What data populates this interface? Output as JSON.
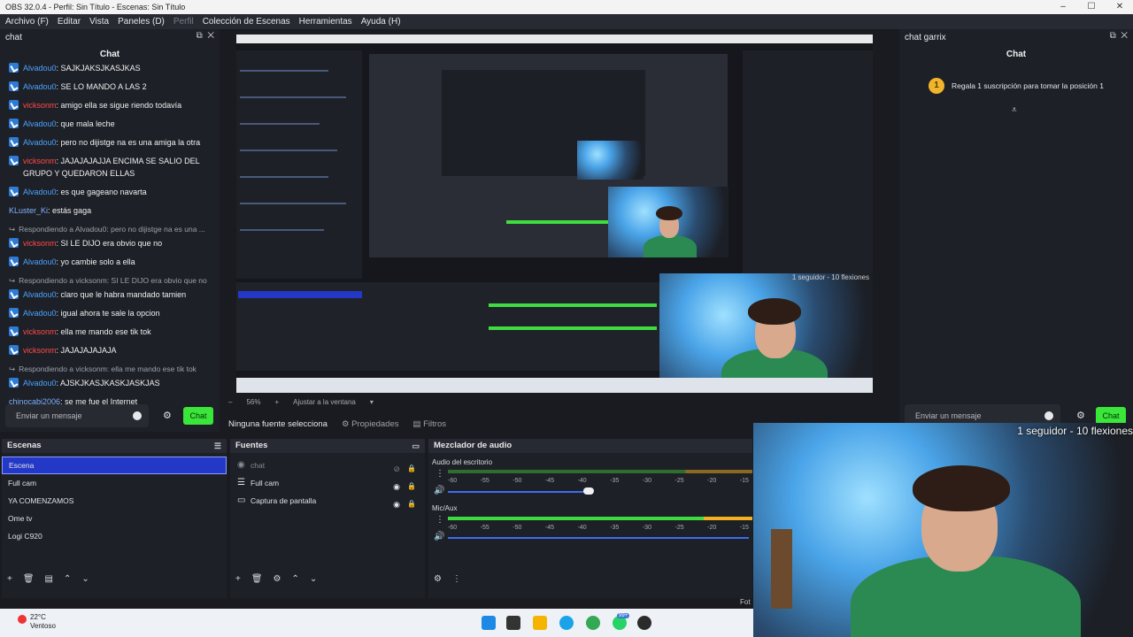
{
  "window": {
    "title": "OBS 32.0.4 - Perfil: Sin Título - Escenas: Sin Título"
  },
  "menu": [
    {
      "label": "Archivo (F)",
      "enabled": true
    },
    {
      "label": "Editar",
      "enabled": true
    },
    {
      "label": "Vista",
      "enabled": true
    },
    {
      "label": "Paneles (D)",
      "enabled": true
    },
    {
      "label": "Perfil",
      "enabled": false
    },
    {
      "label": "Colección de Escenas",
      "enabled": true
    },
    {
      "label": "Herramientas",
      "enabled": true
    },
    {
      "label": "Ayuda (H)",
      "enabled": true
    }
  ],
  "left_dock": {
    "dock_title": "chat",
    "chat_header": "Chat",
    "messages": [
      {
        "user": "Alvadou0",
        "text": "SAJKJAKSJKASJKAS",
        "color": "blue",
        "badge": true
      },
      {
        "user": "Alvadou0",
        "text": "SE LO MANDO A LAS 2",
        "color": "blue",
        "badge": true
      },
      {
        "user": "vicksonm",
        "text": "amigo ella se sigue riendo todavía",
        "color": "red",
        "badge": true
      },
      {
        "user": "Alvadou0",
        "text": "que mala leche",
        "color": "blue",
        "badge": true
      },
      {
        "user": "Alvadou0",
        "text": "pero no dijistge na es una amiga la otra",
        "color": "blue",
        "badge": true
      },
      {
        "user": "vicksonm",
        "text": "JAJAJAJAJJA ENCIMA SE SALIO DEL GRUPO Y QUEDARON ELLAS",
        "color": "red",
        "badge": true
      },
      {
        "user": "Alvadou0",
        "text": "es que gageano navarta",
        "color": "blue",
        "badge": true
      },
      {
        "user": "KLuster_Ki",
        "text": "estás gaga",
        "color": "plain",
        "badge": false
      },
      {
        "reply": "Respondiendo a Alvadou0: pero no dijistge na es una ...",
        "user": "vicksonm",
        "text": "SI LE DIJO era obvio que no",
        "color": "red",
        "badge": true
      },
      {
        "user": "Alvadou0",
        "text": "yo cambie solo a ella",
        "color": "blue",
        "badge": true
      },
      {
        "reply": "Respondiendo a vicksonm: SI LE DIJO era obvio que no",
        "user": "Alvadou0",
        "text": "claro que le habra mandado tamien",
        "color": "blue",
        "badge": true
      },
      {
        "user": "Alvadou0",
        "text": "igual ahora te sale la opcion",
        "color": "blue",
        "badge": true
      },
      {
        "user": "vicksonm",
        "text": "ella me mando ese tik tok",
        "color": "red",
        "badge": true
      },
      {
        "user": "vicksonm",
        "text": "JAJAJAJAJAJA",
        "color": "red",
        "badge": true
      },
      {
        "reply": "Respondiendo a vicksonm: ella me mando ese tik tok",
        "user": "Alvadou0",
        "text": "AJSKJKASJKASKJASKJAS",
        "color": "blue",
        "badge": true
      },
      {
        "user": "chinocabj2006",
        "text": "se me fue el Internet",
        "color": "plain",
        "badge": false
      }
    ],
    "input_placeholder": "Enviar un mensaje",
    "send_label": "Chat"
  },
  "right_dock": {
    "dock_title": "chat garrix",
    "chat_header": "Chat",
    "gift_text": "Regala 1 suscripción para tomar la posición 1",
    "gift_badge": "1",
    "input_placeholder": "Enviar un mensaje",
    "send_label": "Chat"
  },
  "preview": {
    "zoom": "56%",
    "fit_label": "Ajustar a la ventana",
    "cam_label": "1 seguidor - 10 flexiones"
  },
  "source_bar": {
    "no_source": "Ninguna fuente selecciona",
    "properties": "Propiedades",
    "filters": "Filtros"
  },
  "scenes": {
    "title": "Escenas",
    "items": [
      "Escena",
      "Full cam",
      "YA COMENZAMOS",
      "Ome tv",
      "Logi C920"
    ],
    "selected": 0
  },
  "sources": {
    "title": "Fuentes",
    "items": [
      {
        "name": "chat",
        "icon": "browser-icon",
        "visible": false
      },
      {
        "name": "Full cam",
        "icon": "group-icon",
        "visible": true
      },
      {
        "name": "Captura de pantalla",
        "icon": "monitor-icon",
        "visible": true
      }
    ]
  },
  "mixer": {
    "title": "Mezclador de audio",
    "channels": [
      {
        "name": "Audio del escritorio",
        "volume": 0.58
      },
      {
        "name": "Mic/Aux",
        "volume": 0.0
      }
    ],
    "scale": [
      "-60",
      "-55",
      "-50",
      "-45",
      "-40",
      "-35",
      "-30",
      "-25",
      "-20",
      "-15"
    ]
  },
  "overlay": {
    "text": "1 seguidor - 10 flexiones"
  },
  "taskbar": {
    "temp": "22°C",
    "weather": "Ventoso",
    "badge": "99+",
    "bottom_right": "Fot"
  },
  "colors": {
    "accent_green": "#39e639",
    "selection_blue": "#2438c8",
    "user_blue": "#4aa3ff",
    "user_red": "#ff4a4a"
  }
}
